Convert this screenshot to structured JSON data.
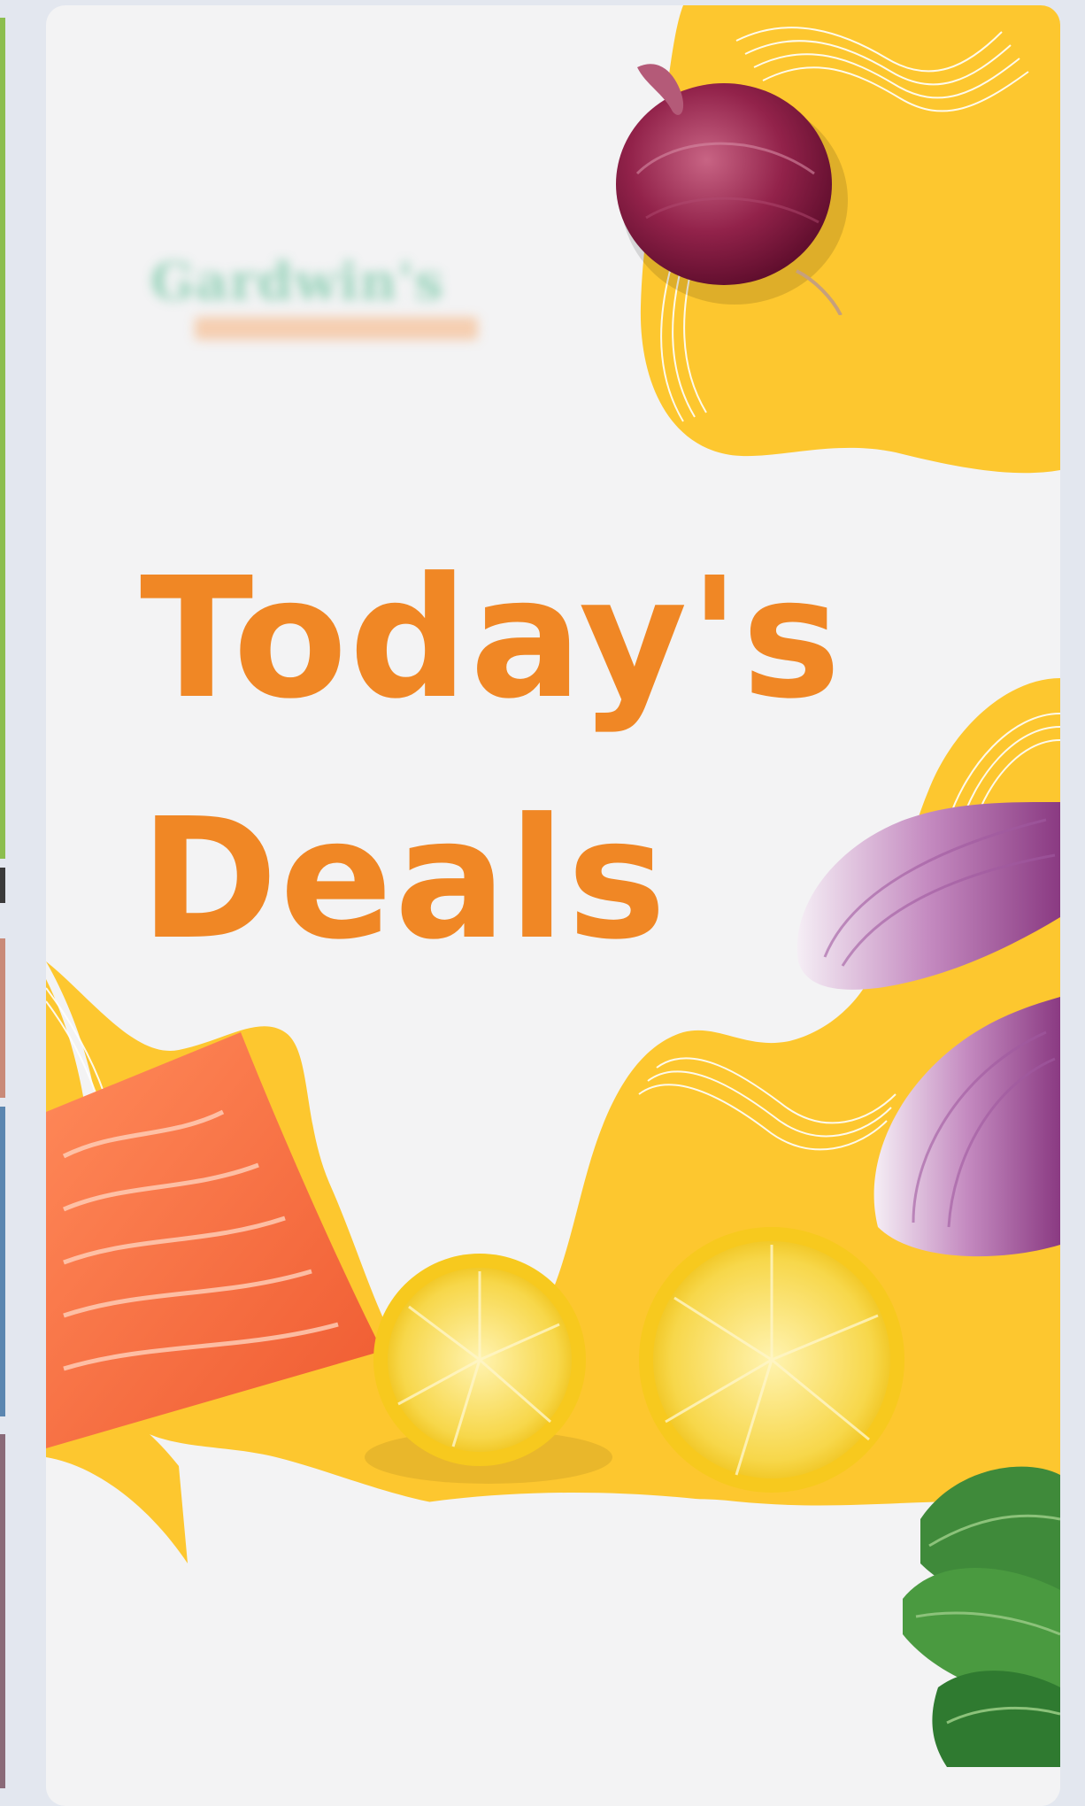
{
  "promo": {
    "logo_text": "Gardwin's",
    "headline_line1": "Today's",
    "headline_line2": "Deals"
  },
  "colors": {
    "page_background": "#e3e7ef",
    "card_background": "#f3f3f4",
    "accent_yellow": "#fdc72f",
    "headline_orange": "#f08725",
    "logo_green": "#7cc9a9"
  },
  "images": [
    "red-onion",
    "sliced-red-onion",
    "salmon-fillet",
    "lemon-halves",
    "spinach-leaves",
    "brand-logo"
  ]
}
